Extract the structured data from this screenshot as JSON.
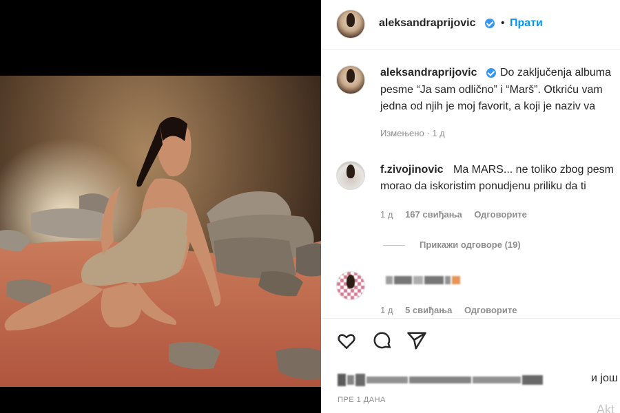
{
  "post": {
    "username": "aleksandraprijovic",
    "follow_label": "Прати",
    "separator": "•"
  },
  "caption": {
    "username": "aleksandraprijovic",
    "line1": "Do zaključenja albuma",
    "line2": "pesme “Ja sam odlično” i “Marš”. Otkriću vam",
    "line3": "jedna od njih je moj favorit, a koji je naziv va",
    "edited": "Измењено · 1 д"
  },
  "comments": [
    {
      "username": "f.zivojinovic",
      "line1": "Ma MARS... ne toliko zbog pesm",
      "line2": "morao da iskoristim ponudjenu priliku da ti",
      "age": "1 д",
      "likes": "167 свиђања",
      "reply": "Одговорите",
      "view_replies": "Прикажи одговоре (19)"
    },
    {
      "username": "",
      "age": "1 д",
      "likes": "5 свиђања",
      "reply": "Одговорите"
    }
  ],
  "likes_suffix": "и још",
  "timestamp": "ПРЕ 1 ДАНА",
  "watermark": "Akt",
  "icons": [
    "heart-icon",
    "comment-icon",
    "share-icon",
    "verified-icon"
  ],
  "colors": {
    "accent": "#0095f6",
    "verified": "#3897f0",
    "text": "#262626",
    "muted": "#8e8e8e"
  }
}
